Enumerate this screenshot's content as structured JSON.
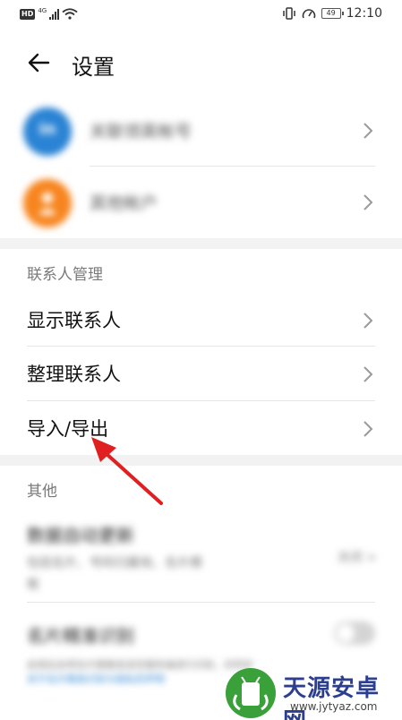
{
  "status_bar": {
    "hd": "HD",
    "network": "4G",
    "battery": "49",
    "time": "12:10"
  },
  "header": {
    "title": "设置"
  },
  "accounts": [
    {
      "label": "关联领英帐号",
      "avatar_text": "in",
      "color": "#2a83d4"
    },
    {
      "label": "其他帐户",
      "avatar_text": "",
      "color": "#f7851f"
    }
  ],
  "contacts_section": {
    "title": "联系人管理",
    "items": [
      {
        "label": "显示联系人"
      },
      {
        "label": "整理联系人"
      },
      {
        "label": "导入/导出"
      }
    ]
  },
  "other_section": {
    "title": "其他",
    "auto_update": {
      "title": "数据自动更新",
      "subtitle": "包括名片、号码归属地、名片模",
      "subtitle2": "板",
      "value": "关闭 >"
    },
    "card_recognition": {
      "title": "名片精准识别",
      "desc": "启用后会将名片图像发送至服务端进行识别，并同步",
      "desc_link": "关于名片精准识别与隐私的声明"
    }
  },
  "watermark": {
    "name": "天源安卓网",
    "url": "www.jytyaz.com"
  }
}
